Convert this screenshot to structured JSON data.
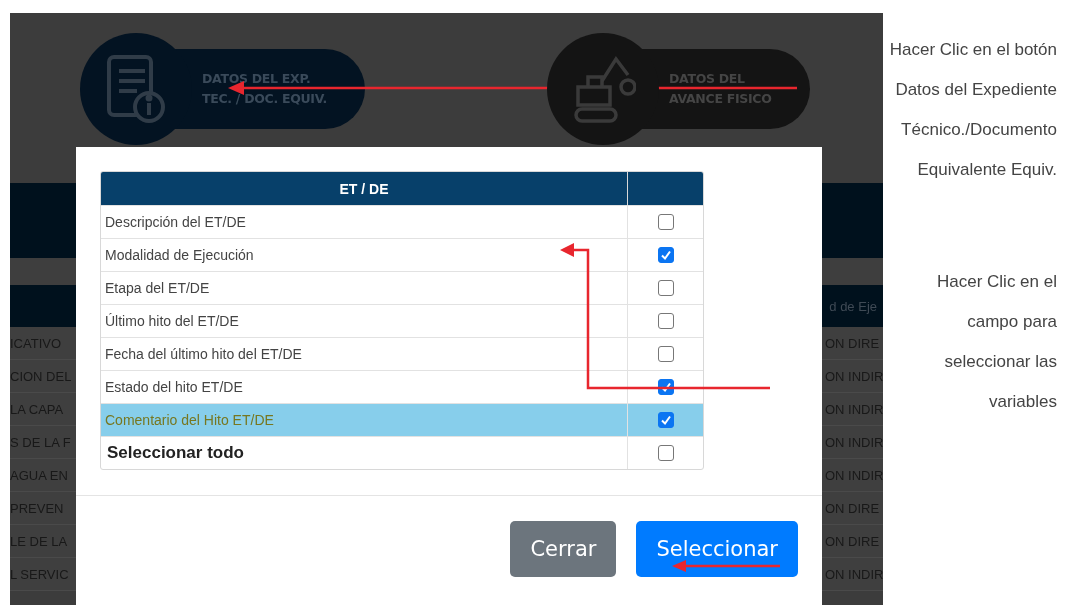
{
  "background_page": {
    "buttons": [
      {
        "kind": "file",
        "lines": [
          "DATOS DEL EXP.",
          "TEC. / DOC. EQUIV."
        ]
      },
      {
        "kind": "excavator",
        "lines": [
          "DATOS DEL",
          "AVANCE FISICO"
        ]
      }
    ],
    "table_header": {
      "column_2": "d de Eje"
    },
    "rows": [
      {
        "column_1": "ICATIVO",
        "column_2": "ON DIRE"
      },
      {
        "column_1": "CION DEL",
        "column_2": "ON INDIR"
      },
      {
        "column_1": "LA CAPA",
        "column_2": "ON INDIR"
      },
      {
        "column_1": "S DE LA F",
        "column_2": "ON INDIR"
      },
      {
        "column_1": "AGUA EN",
        "column_2": "ON INDIR"
      },
      {
        "column_1": "PREVEN",
        "column_2": "ON DIRE"
      },
      {
        "column_1": "LE DE LA",
        "column_2": "ON DIRE"
      },
      {
        "column_1": "L SERVIC",
        "column_2": "ON INDIR"
      }
    ]
  },
  "modal": {
    "header": "ET / DE",
    "rows": [
      {
        "label": "Descripción del ET/DE",
        "checked": false,
        "selected": false
      },
      {
        "label": "Modalidad de Ejecución",
        "checked": true,
        "selected": false
      },
      {
        "label": "Etapa del ET/DE",
        "checked": false,
        "selected": false
      },
      {
        "label": "Último hito del ET/DE",
        "checked": false,
        "selected": false
      },
      {
        "label": "Fecha del último hito del ET/DE",
        "checked": false,
        "selected": false
      },
      {
        "label": "Estado del hito ET/DE",
        "checked": true,
        "selected": false
      },
      {
        "label": "Comentario del Hito ET/DE",
        "checked": true,
        "selected": true
      }
    ],
    "select_all": {
      "label": "Seleccionar todo",
      "checked": false
    },
    "buttons": [
      {
        "label": "Cerrar",
        "kind": "secondary"
      },
      {
        "label": "Seleccionar",
        "kind": "primary"
      }
    ]
  },
  "annotations": [
    {
      "text": "Hacer Clic en el botón Datos del Expediente Técnico./Documento Equivalente Equiv."
    },
    {
      "text": "Hacer Clic en el campo para seleccionar las variables"
    }
  ]
}
